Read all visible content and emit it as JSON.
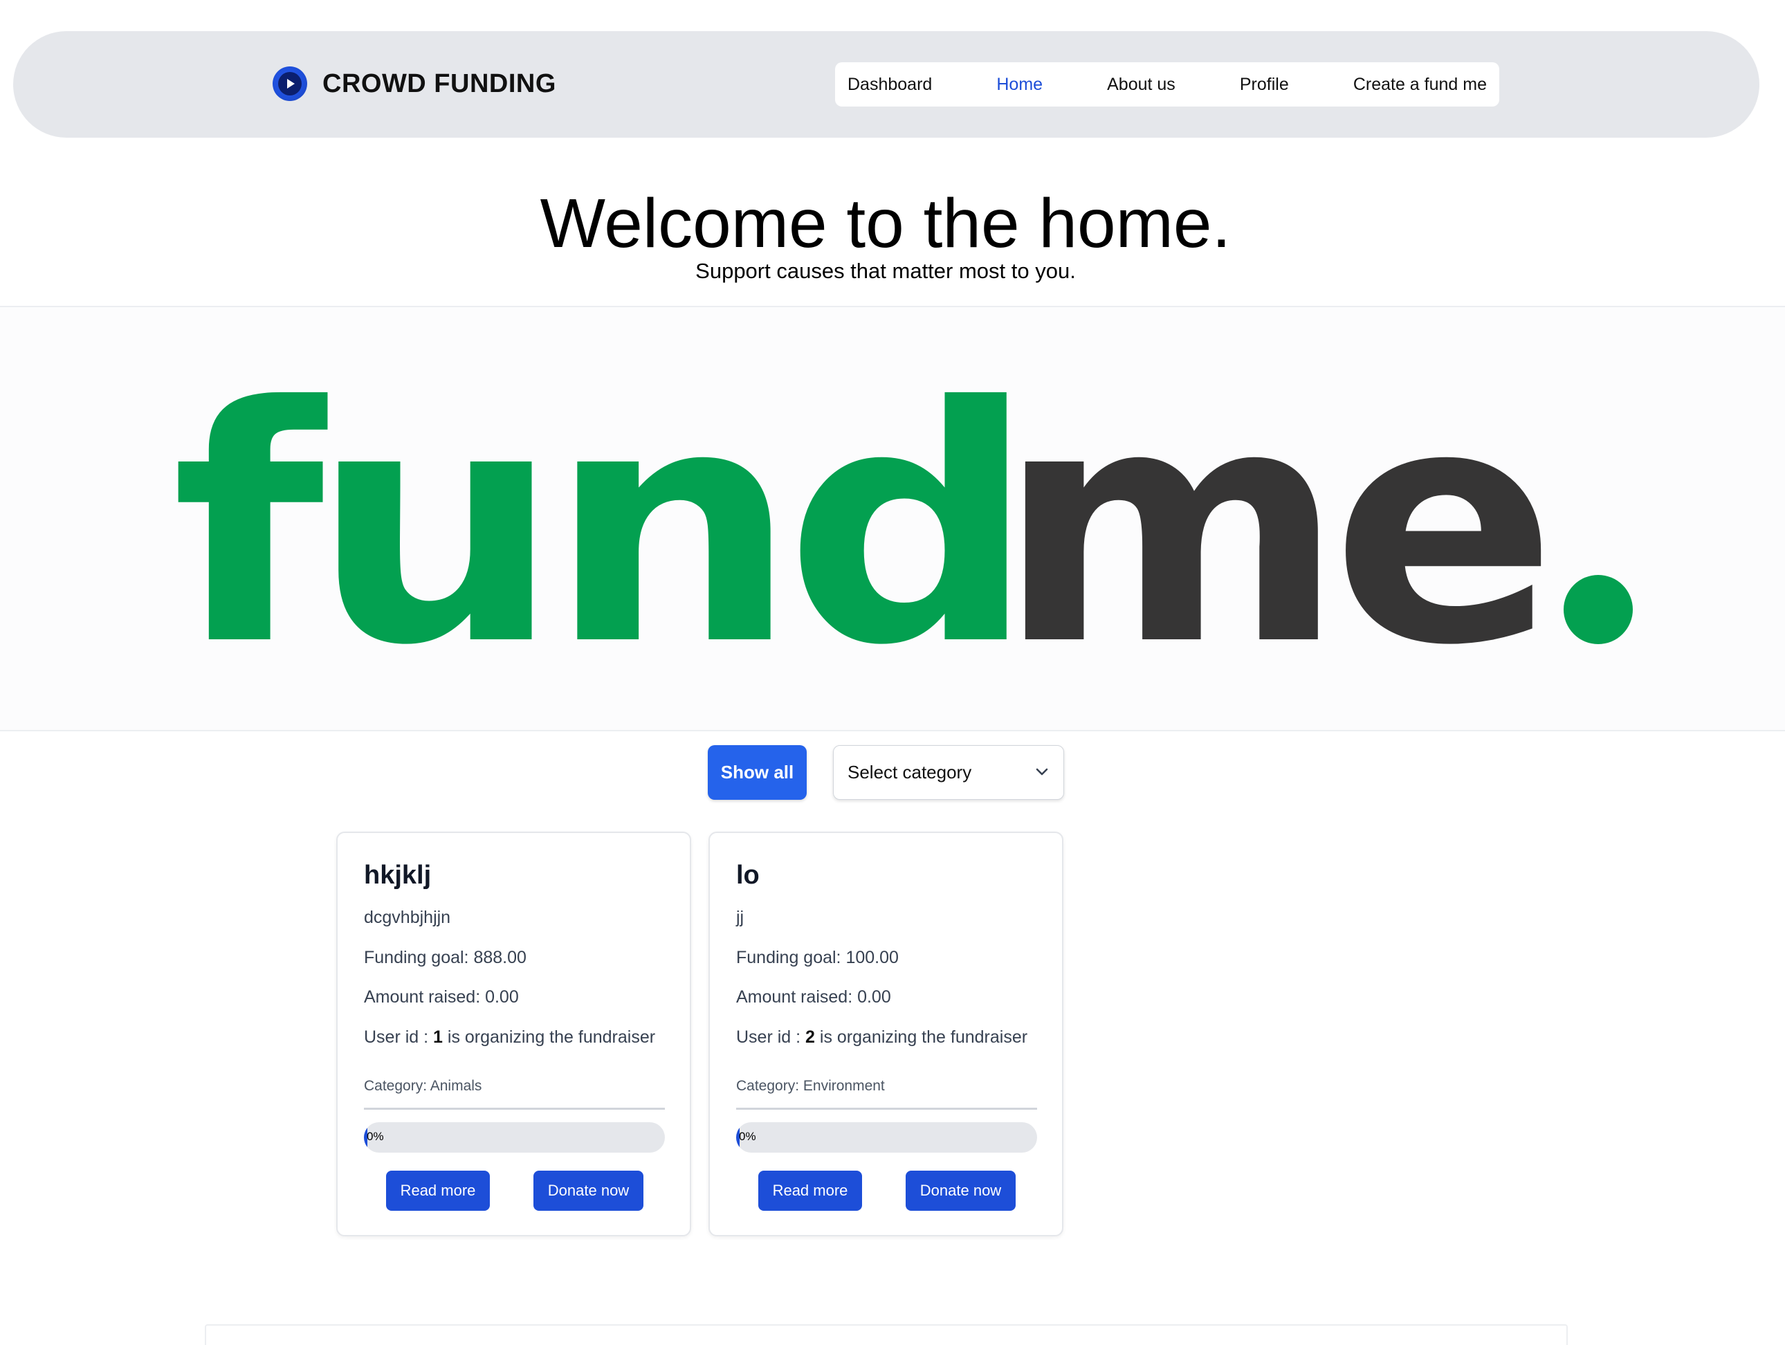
{
  "header": {
    "brand_name": "CROWD FUNDING",
    "brand_icon": "play-circle-icon",
    "nav": [
      {
        "label": "Dashboard",
        "active": false
      },
      {
        "label": "Home",
        "active": true
      },
      {
        "label": "About us",
        "active": false
      },
      {
        "label": "Profile",
        "active": false
      },
      {
        "label": "Create a fund me",
        "active": false
      }
    ]
  },
  "hero": {
    "title": "Welcome to the home.",
    "subtitle": "Support causes that matter most to you."
  },
  "banner": {
    "logo_part1": "fund",
    "logo_part2": "me",
    "logo_dot": ".",
    "colors": {
      "green": "#03a050",
      "dark": "#363535"
    }
  },
  "filters": {
    "show_all_label": "Show all",
    "category_selected": "Select category"
  },
  "campaigns": [
    {
      "title": "hkjklj",
      "description": "dcgvhbjhjjn",
      "funding_goal": "Funding goal: 888.00",
      "amount_raised": "Amount raised: 0.00",
      "organizer_prefix": "User id : ",
      "user_id": "1",
      "organizer_suffix": " is organizing the fundraiser",
      "category": "Category: Animals",
      "progress_percent": 0,
      "progress_label": "0%",
      "read_more_label": "Read more",
      "donate_label": "Donate now"
    },
    {
      "title": "lo",
      "description": "jj",
      "funding_goal": "Funding goal: 100.00",
      "amount_raised": "Amount raised: 0.00",
      "organizer_prefix": "User id : ",
      "user_id": "2",
      "organizer_suffix": " is organizing the fundraiser",
      "category": "Category: Environment",
      "progress_percent": 0,
      "progress_label": "0%",
      "read_more_label": "Read more",
      "donate_label": "Donate now"
    }
  ],
  "theme": {
    "accent": "#2563eb",
    "button": "#1d4ed8",
    "nav_bg": "#e5e7eb"
  }
}
